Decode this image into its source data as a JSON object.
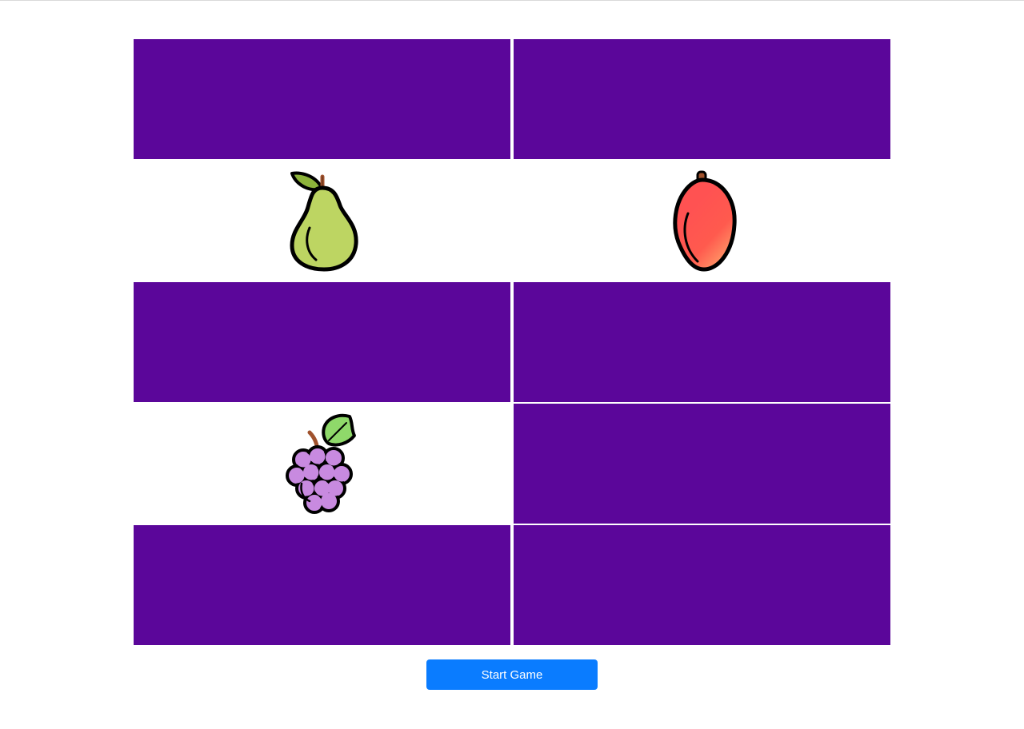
{
  "game": {
    "cards": [
      {
        "state": "hidden"
      },
      {
        "state": "hidden"
      },
      {
        "state": "revealed",
        "fruit": "pear-icon"
      },
      {
        "state": "revealed",
        "fruit": "mango-icon"
      },
      {
        "state": "hidden"
      },
      {
        "state": "hidden"
      },
      {
        "state": "revealed",
        "fruit": "grapes-icon"
      },
      {
        "state": "hidden"
      },
      {
        "state": "hidden"
      },
      {
        "state": "hidden"
      }
    ],
    "colors": {
      "card_back": "#5b069a",
      "card_face": "#ffffff",
      "button": "#0a7cff"
    }
  },
  "controls": {
    "start_label": "Start Game"
  }
}
